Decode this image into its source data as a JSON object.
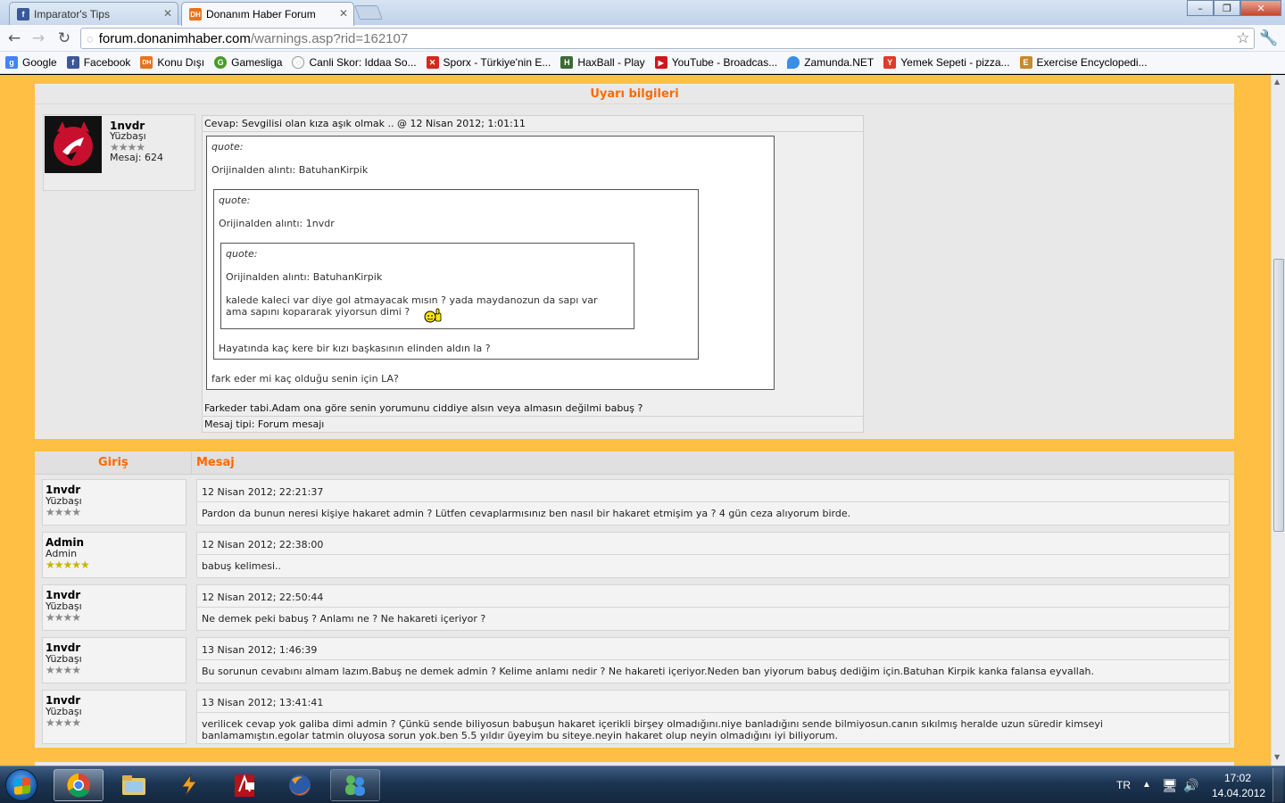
{
  "browser": {
    "tabs": [
      {
        "title": "Imparator's Tips",
        "icon": "facebook-icon",
        "active": false
      },
      {
        "title": "Donanım Haber Forum",
        "icon": "dh-icon",
        "active": true
      }
    ],
    "url_host": "forum.donanimhaber.com",
    "url_path": "/warnings.asp?rid=162107",
    "bookmarks": [
      {
        "label": "Google",
        "icon": "google-icon",
        "color": "#4285f4"
      },
      {
        "label": "Facebook",
        "icon": "facebook-icon",
        "color": "#3b5998"
      },
      {
        "label": "Konu Dışı",
        "icon": "dh-icon",
        "color": "#e8731c"
      },
      {
        "label": "Gamesliga",
        "icon": "shield-icon",
        "color": "#4a9a2a"
      },
      {
        "label": "Canli Skor: Iddaa So...",
        "icon": "spinner-icon",
        "color": "#666666"
      },
      {
        "label": "Sporx - Türkiye'nin E...",
        "icon": "sporx-icon",
        "color": "#d9261c"
      },
      {
        "label": "HaxBall - Play",
        "icon": "haxball-icon",
        "color": "#3a6b35"
      },
      {
        "label": "YouTube - Broadcas...",
        "icon": "youtube-icon",
        "color": "#cc181e"
      },
      {
        "label": "Zamunda.NET",
        "icon": "drop-icon",
        "color": "#3a8ee6"
      },
      {
        "label": "Yemek Sepeti - pizza...",
        "icon": "yemeksepeti-icon",
        "color": "#e03a2a"
      },
      {
        "label": "Exercise Encyclopedi...",
        "icon": "exercise-icon",
        "color": "#c98a2a"
      }
    ]
  },
  "warning": {
    "heading": "Uyarı bilgileri",
    "user": {
      "name": "1nvdr",
      "rank": "Yüzbaşı",
      "stars": "★★★★",
      "posts": "Mesaj: 624"
    },
    "reply_line": "Cevap: Sevgilisi olan kıza aşık olmak .. @ 12 Nisan 2012; 1:01:11",
    "quote_label": "quote:",
    "q1_from": "Orijinalden alıntı: BatuhanKirpik",
    "q2_from": "Orijinalden alıntı: 1nvdr",
    "q3_from": "Orijinalden alıntı: BatuhanKirpik",
    "q3_text1": "kalede kaleci var diye gol atmayacak mısın ? yada maydanozun da sapı var",
    "q3_text2": "ama sapını koparарак yiyorsun dimi ?",
    "q2_text": "Hayatında kaç kere bir kızı başkasının elinden aldın la ?",
    "q1_text": "fark eder mi kaç olduğu senin için LA?",
    "body": "Farkeder tabi.Adam ona göre senin yorumunu ciddiye alsın veya almasın değilmi babuş ?",
    "type_line": "Mesaj tipi: Forum mesajı"
  },
  "history": {
    "col_login": "Giriş",
    "col_message": "Mesaj",
    "rows": [
      {
        "name": "1nvdr",
        "rank": "Yüzbaşı",
        "stars": "★★★★",
        "star_color": "gray",
        "date": "12 Nisan 2012; 22:21:37",
        "text": "Pardon da bunun neresi kişiye hakaret admin ? Lütfen cevaplarmısınız ben nasıl bir hakaret etmişim ya ? 4 gün ceza alıyorum birde."
      },
      {
        "name": "Admin",
        "rank": "Admin",
        "stars": "★★★★★",
        "star_color": "gold",
        "date": "12 Nisan 2012; 22:38:00",
        "text": "babuş kelimesi.."
      },
      {
        "name": "1nvdr",
        "rank": "Yüzbaşı",
        "stars": "★★★★",
        "star_color": "gray",
        "date": "12 Nisan 2012; 22:50:44",
        "text": "Ne demek peki babuş ? Anlamı ne ? Ne hakareti içeriyor ?"
      },
      {
        "name": "1nvdr",
        "rank": "Yüzbaşı",
        "stars": "★★★★",
        "star_color": "gray",
        "date": "13 Nisan 2012; 1:46:39",
        "text": "Bu sorunun cevabını almam lazım.Babuş ne demek admin ? Kelime anlamı nedir ? Ne hakareti içeriyor.Neden ban yiyorum babuş dediğim için.Batuhan Kirpik kanka falansa eyvallah."
      },
      {
        "name": "1nvdr",
        "rank": "Yüzbaşı",
        "stars": "★★★★",
        "star_color": "gray",
        "date": "13 Nisan 2012; 13:41:41",
        "text": "verilicek cevap yok galiba dimi admin ? Çünkü sende biliyosun babuşun hakaret içerikli birşey olmadığını.niye banladığını sende bilmiyosun.canın sıkılmış heralde uzun süredir kimseyi banlamamıştın.egolar tatmin oluyosa sorun yok.ben 5.5 yıldır üyeyim bu siteye.neyin hakaret olup neyin olmadığını iyi biliyorum."
      }
    ]
  },
  "taskbar": {
    "lang": "TR",
    "time": "17:02",
    "date": "14.04.2012"
  }
}
